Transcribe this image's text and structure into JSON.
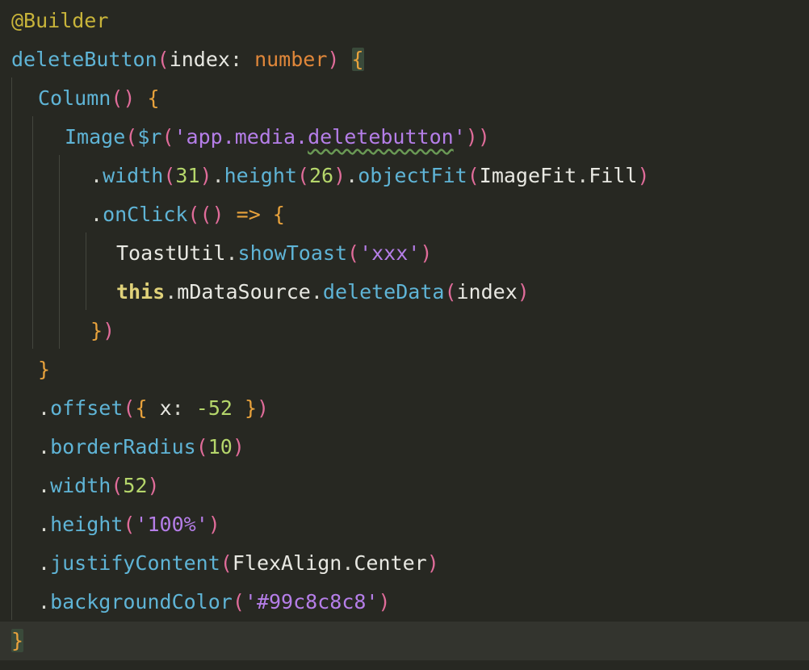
{
  "editor": {
    "current_line": 17,
    "lines": [
      {
        "text": "@Builder",
        "indent": 0
      },
      {
        "text": "deleteButton(index: number) {",
        "indent": 0
      },
      {
        "text": "Column() {",
        "indent": 1
      },
      {
        "text": "Image($r('app.media.deletebutton'))",
        "indent": 2
      },
      {
        "text": ".width(31).height(26).objectFit(ImageFit.Fill)",
        "indent": 3
      },
      {
        "text": ".onClick(() => {",
        "indent": 3
      },
      {
        "text": "ToastUtil.showToast('xxx')",
        "indent": 4
      },
      {
        "text": "this.mDataSource.deleteData(index)",
        "indent": 4
      },
      {
        "text": "})",
        "indent": 3
      },
      {
        "text": "}",
        "indent": 1
      },
      {
        "text": ".offset({ x: -52 })",
        "indent": 1
      },
      {
        "text": ".borderRadius(10)",
        "indent": 1
      },
      {
        "text": ".width(52)",
        "indent": 1
      },
      {
        "text": ".height('100%')",
        "indent": 1
      },
      {
        "text": ".justifyContent(FlexAlign.Center)",
        "indent": 1
      },
      {
        "text": ".backgroundColor('#99c8c8c8')",
        "indent": 1
      },
      {
        "text": "}",
        "indent": 0
      }
    ]
  },
  "colors": {
    "background": "#272822",
    "current_line": "#33342e",
    "plain": "#e8e8e2",
    "decorator": "#c8b43a",
    "function": "#5fb4d6",
    "type": "#e0873a",
    "paren": "#e06c9a",
    "brace": "#e8a23c",
    "string": "#b57ee8",
    "number": "#b5d66b",
    "keyword": "#e0d27a",
    "punct": "#d8d8d0"
  }
}
